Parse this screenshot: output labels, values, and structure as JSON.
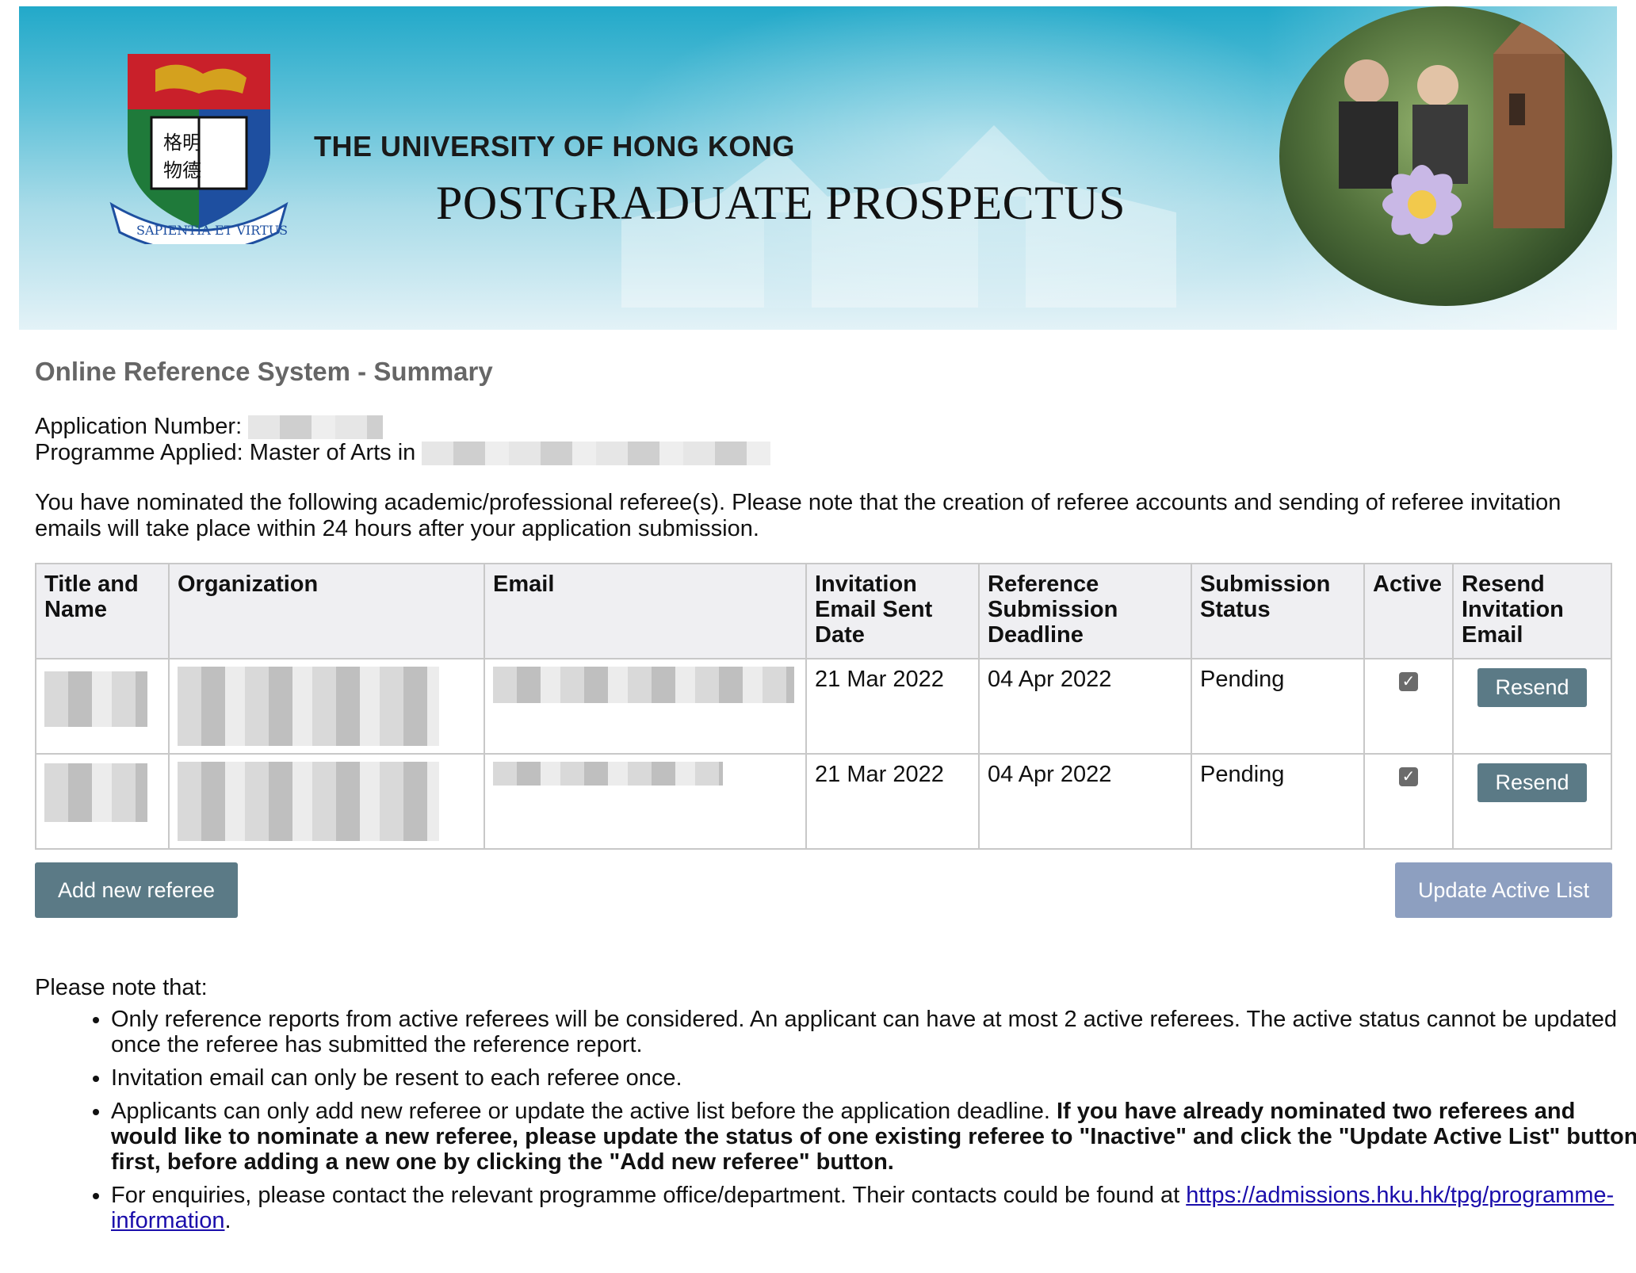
{
  "banner": {
    "university_name": "THE UNIVERSITY OF HONG KONG",
    "prospectus_title": "POSTGRADUATE PROSPECTUS",
    "motto": "SAPIENTIA ET VIRTUS"
  },
  "page_title": "Online Reference System - Summary",
  "application": {
    "number_label": "Application Number:",
    "programme_label": "Programme Applied: Master of Arts in"
  },
  "intro_text": "You have nominated the following academic/professional referee(s). Please note that the creation of referee accounts and sending of referee invitation emails will take place within 24 hours after your application submission.",
  "table": {
    "headers": [
      "Title and Name",
      "Organization",
      "Email",
      "Invitation Email Sent Date",
      "Reference Submission Deadline",
      "Submission Status",
      "Active",
      "Resend Invitation Email"
    ],
    "rows": [
      {
        "sent_date": "21 Mar 2022",
        "deadline": "04 Apr 2022",
        "status": "Pending",
        "active": true,
        "resend_label": "Resend"
      },
      {
        "sent_date": "21 Mar 2022",
        "deadline": "04 Apr 2022",
        "status": "Pending",
        "active": true,
        "resend_label": "Resend"
      }
    ]
  },
  "buttons": {
    "add_referee": "Add new referee",
    "update_active": "Update Active List"
  },
  "notes": {
    "heading": "Please note that:",
    "item1": "Only reference reports from active referees will be considered. An applicant can have at most 2 active referees. The active status cannot be updated once the referee has submitted the reference report.",
    "item2": "Invitation email can only be resent to each referee once.",
    "item3_plain": "Applicants can only add new referee or update the active list before the application deadline. ",
    "item3_bold": "If you have already nominated two referees and would like to nominate a new referee, please update the status of one existing referee to \"Inactive\" and click the \"Update Active List\" button first, before adding a new one by clicking the \"Add new referee\" button.",
    "item4_text": "For enquiries, please contact the relevant programme office/department. Their contacts could be found at ",
    "item4_link": "https://admissions.hku.hk/tpg/programme-information",
    "item4_end": "."
  },
  "colors": {
    "button_primary": "#5b7a86",
    "button_update": "#8d9fc0",
    "title_gray": "#666666"
  }
}
